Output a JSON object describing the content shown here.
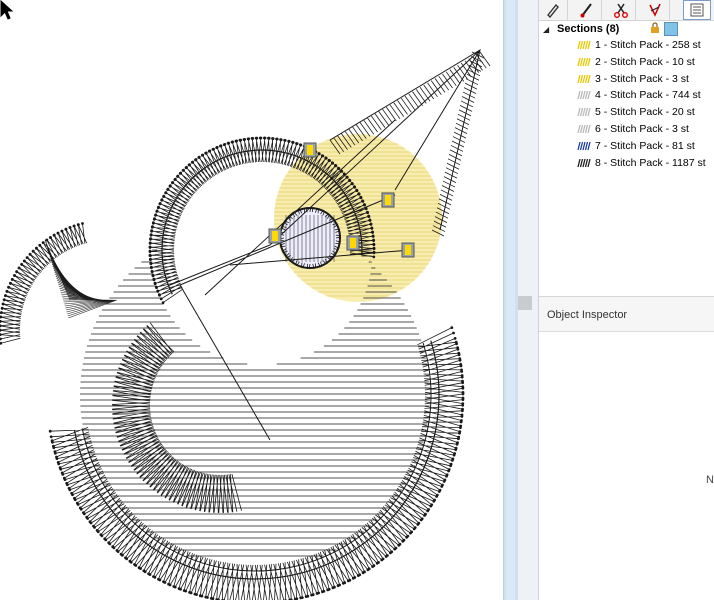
{
  "canvas": {
    "background": "#ffffff",
    "stitch_color": "#1a1a1a",
    "highlight_color": "#f7e9a0"
  },
  "toolbar": {
    "buttons": [
      {
        "icon": "pencil-icon"
      },
      {
        "icon": "brush-icon"
      },
      {
        "icon": "scissors-icon"
      },
      {
        "icon": "stitch-edit-icon"
      },
      {
        "icon": "list-view-icon"
      }
    ]
  },
  "sections": {
    "title": "Sections (8)",
    "items": [
      {
        "label": "1 - Stitch Pack - 258 st",
        "color": "#e8c800"
      },
      {
        "label": "2 - Stitch Pack - 10 st",
        "color": "#e8c800"
      },
      {
        "label": "3 - Stitch Pack - 3 st",
        "color": "#e8c800"
      },
      {
        "label": "4 - Stitch Pack - 744 st",
        "color": "#b8b8b8"
      },
      {
        "label": "5 - Stitch Pack - 20 st",
        "color": "#b8b8b8"
      },
      {
        "label": "6 - Stitch Pack - 3 st",
        "color": "#b8b8b8"
      },
      {
        "label": "7 - Stitch Pack - 81 st",
        "color": "#2040a0"
      },
      {
        "label": "8 - Stitch Pack - 1187 st",
        "color": "#202020"
      }
    ]
  },
  "inspector": {
    "title": "Object Inspector",
    "empty_text": "N"
  }
}
